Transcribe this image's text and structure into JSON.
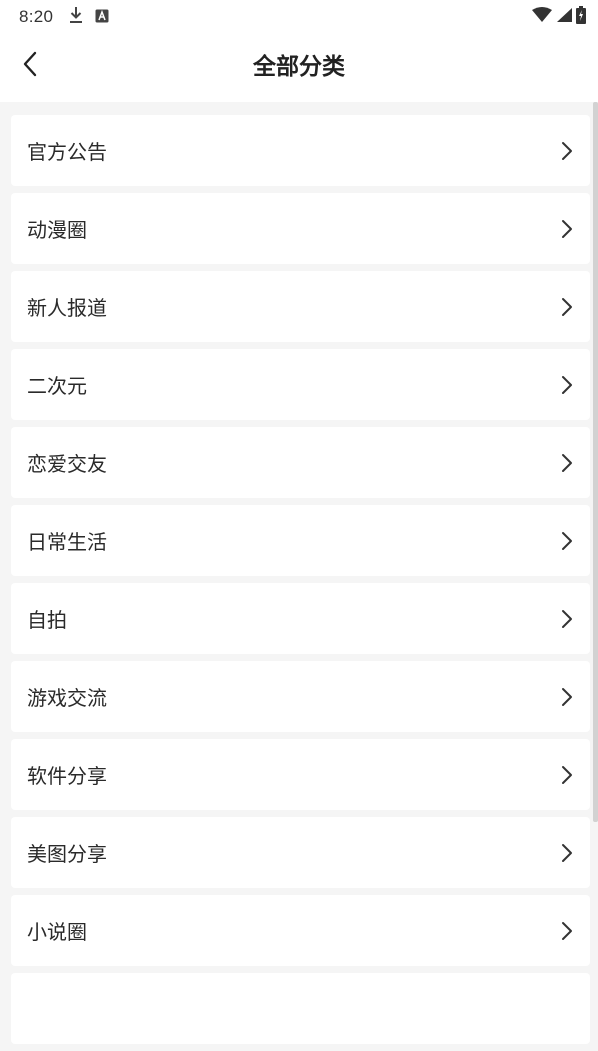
{
  "status_bar": {
    "time": "8:20"
  },
  "header": {
    "title": "全部分类"
  },
  "categories": [
    {
      "label": "官方公告"
    },
    {
      "label": "动漫圈"
    },
    {
      "label": "新人报道"
    },
    {
      "label": "二次元"
    },
    {
      "label": "恋爱交友"
    },
    {
      "label": "日常生活"
    },
    {
      "label": "自拍"
    },
    {
      "label": "游戏交流"
    },
    {
      "label": "软件分享"
    },
    {
      "label": "美图分享"
    },
    {
      "label": "小说圈"
    },
    {
      "label": ""
    }
  ],
  "icons": {
    "back": "chevron-left-icon",
    "item_arrow": "chevron-right-icon",
    "status": [
      "download-icon",
      "accessibility-icon",
      "wifi-icon",
      "cell-signal-icon",
      "battery-icon"
    ]
  },
  "colors": {
    "background": "#f5f5f5",
    "card": "#ffffff",
    "text": "#222222"
  }
}
